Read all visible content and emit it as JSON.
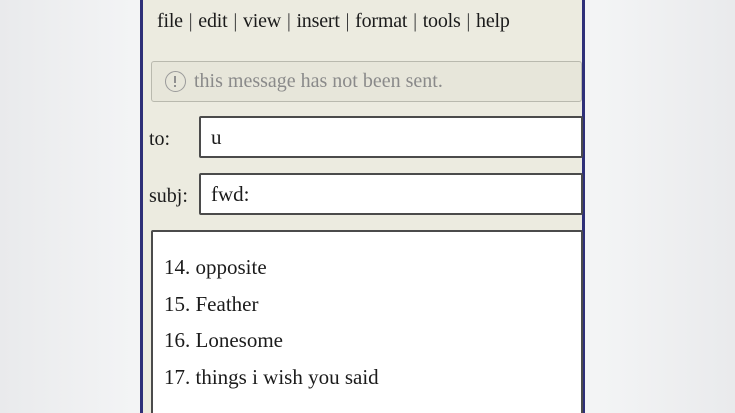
{
  "menu": {
    "items": [
      {
        "label": "file"
      },
      {
        "label": "edit"
      },
      {
        "label": "view"
      },
      {
        "label": "insert"
      },
      {
        "label": "format"
      },
      {
        "label": "tools"
      },
      {
        "label": "help"
      }
    ],
    "separator": "|"
  },
  "notice": {
    "icon": "info-icon",
    "text": "this message has not been sent."
  },
  "to": {
    "label": "to:",
    "value": "u"
  },
  "subject": {
    "label": "subj:",
    "value": "fwd:"
  },
  "body": {
    "lines": [
      "14. opposite",
      "15. Feather",
      "16. Lonesome",
      "17. things i wish you said"
    ]
  },
  "colors": {
    "window_background": "#ecebe0",
    "window_border": "#2e2f78",
    "notice_text": "#8a8a8a",
    "field_border": "#4b4b4b"
  }
}
